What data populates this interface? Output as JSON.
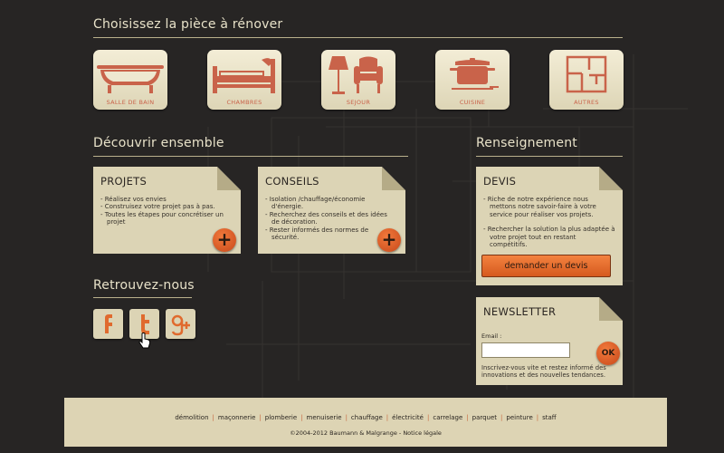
{
  "rooms_section": {
    "title": "Choisissez la pièce à rénover",
    "rooms": [
      {
        "label": "SALLE DE BAIN",
        "icon": "bathtub-icon"
      },
      {
        "label": "CHAMBRES",
        "icon": "bed-icon"
      },
      {
        "label": "SEJOUR",
        "icon": "lamp-armchair-icon"
      },
      {
        "label": "CUISINE",
        "icon": "cooking-pot-icon"
      },
      {
        "label": "AUTRES",
        "icon": "floor-plan-icon"
      }
    ]
  },
  "discover_section": {
    "title": "Découvrir ensemble",
    "projets": {
      "title": "PROJETS",
      "items": [
        "- Réalisez vos envies",
        "- Construisez votre projet pas à pas.",
        "- Toutes les étapes pour concrétiser un projet"
      ],
      "button": "+"
    },
    "conseils": {
      "title": "CONSEILS",
      "items": [
        "- Isolation /chauffage/économie d'énergie.",
        "- Recherchez des conseils et des idées de décoration.",
        "- Rester informés des normes de sécurité."
      ],
      "button": "+"
    }
  },
  "social_section": {
    "title": "Retrouvez-nous",
    "links": [
      {
        "name": "facebook",
        "icon": "facebook-icon"
      },
      {
        "name": "twitter",
        "icon": "twitter-icon"
      },
      {
        "name": "google-plus",
        "icon": "google-plus-icon"
      }
    ]
  },
  "info_section": {
    "title": "Renseignement",
    "devis": {
      "title": "DEVIS",
      "items": [
        "- Riche de notre expérience nous mettons notre savoir-faire à votre service pour réaliser vos projets.",
        "- Rechercher la solution la plus adaptée à votre projet tout en restant compétitifs."
      ],
      "button": "demander un devis"
    },
    "newsletter": {
      "title": "NEWSLETTER",
      "email_label": "Email :",
      "email_value": "",
      "button": "OK",
      "text": "Inscrivez-vous vite et restez informé des innovations et des nouvelles tendances."
    }
  },
  "footer": {
    "links": [
      "démolition",
      "maçonnerie",
      "plomberie",
      "menuiserie",
      "chauffage",
      "électricité",
      "carrelage",
      "parquet",
      "peinture",
      "staff"
    ],
    "copyright": "©2004-2012 Baumann & Malgrange - Notice légale"
  },
  "colors": {
    "background": "#272524",
    "card": "#dcd4b5",
    "accent": "#e06a2e",
    "icon": "#c9634a"
  }
}
